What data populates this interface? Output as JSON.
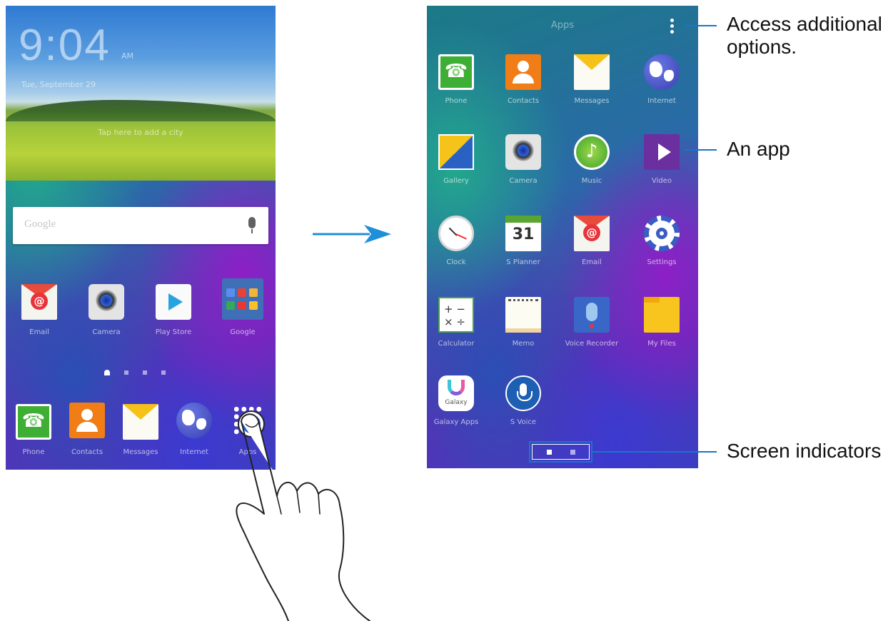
{
  "home_screen": {
    "clock": {
      "time": "9:04",
      "ampm": "AM",
      "date": "Tue, September 29",
      "hint": "Tap here to add a city"
    },
    "search": {
      "placeholder": "Google"
    },
    "row_apps": [
      {
        "label": "Email",
        "icon": "email-icon"
      },
      {
        "label": "Camera",
        "icon": "camera-icon"
      },
      {
        "label": "Play Store",
        "icon": "play-store-icon"
      },
      {
        "label": "Google",
        "icon": "google-folder-icon"
      }
    ],
    "page_indicator": {
      "count": 4,
      "active_index": 0
    },
    "dock": [
      {
        "label": "Phone",
        "icon": "phone-icon"
      },
      {
        "label": "Contacts",
        "icon": "contacts-icon"
      },
      {
        "label": "Messages",
        "icon": "messages-icon"
      },
      {
        "label": "Internet",
        "icon": "internet-icon"
      },
      {
        "label": "Apps",
        "icon": "apps-grid-icon"
      }
    ]
  },
  "apps_screen": {
    "title": "Apps",
    "apps": [
      {
        "label": "Phone",
        "icon": "phone-icon"
      },
      {
        "label": "Contacts",
        "icon": "contacts-icon"
      },
      {
        "label": "Messages",
        "icon": "messages-icon"
      },
      {
        "label": "Internet",
        "icon": "internet-icon"
      },
      {
        "label": "Gallery",
        "icon": "gallery-icon"
      },
      {
        "label": "Camera",
        "icon": "camera-icon"
      },
      {
        "label": "Music",
        "icon": "music-icon"
      },
      {
        "label": "Video",
        "icon": "video-icon"
      },
      {
        "label": "Clock",
        "icon": "clock-icon"
      },
      {
        "label": "S Planner",
        "icon": "calendar-icon",
        "day": "31"
      },
      {
        "label": "Email",
        "icon": "email-icon"
      },
      {
        "label": "Settings",
        "icon": "gear-icon"
      },
      {
        "label": "Calculator",
        "icon": "calculator-icon"
      },
      {
        "label": "Memo",
        "icon": "memo-icon"
      },
      {
        "label": "Voice Recorder",
        "icon": "microphone-icon"
      },
      {
        "label": "My Files",
        "icon": "folder-icon"
      },
      {
        "label": "Galaxy Apps",
        "icon": "galaxy-apps-icon",
        "icon_text": "Galaxy"
      },
      {
        "label": "S Voice",
        "icon": "s-voice-icon"
      }
    ],
    "page_indicator": {
      "count": 2,
      "active_index": 0
    }
  },
  "callouts": {
    "options": "Access additional options.",
    "app": "An app",
    "indicators": "Screen indicators"
  },
  "colors": {
    "callout_line": "#1875c9",
    "arrow": "#1e8fd8"
  }
}
